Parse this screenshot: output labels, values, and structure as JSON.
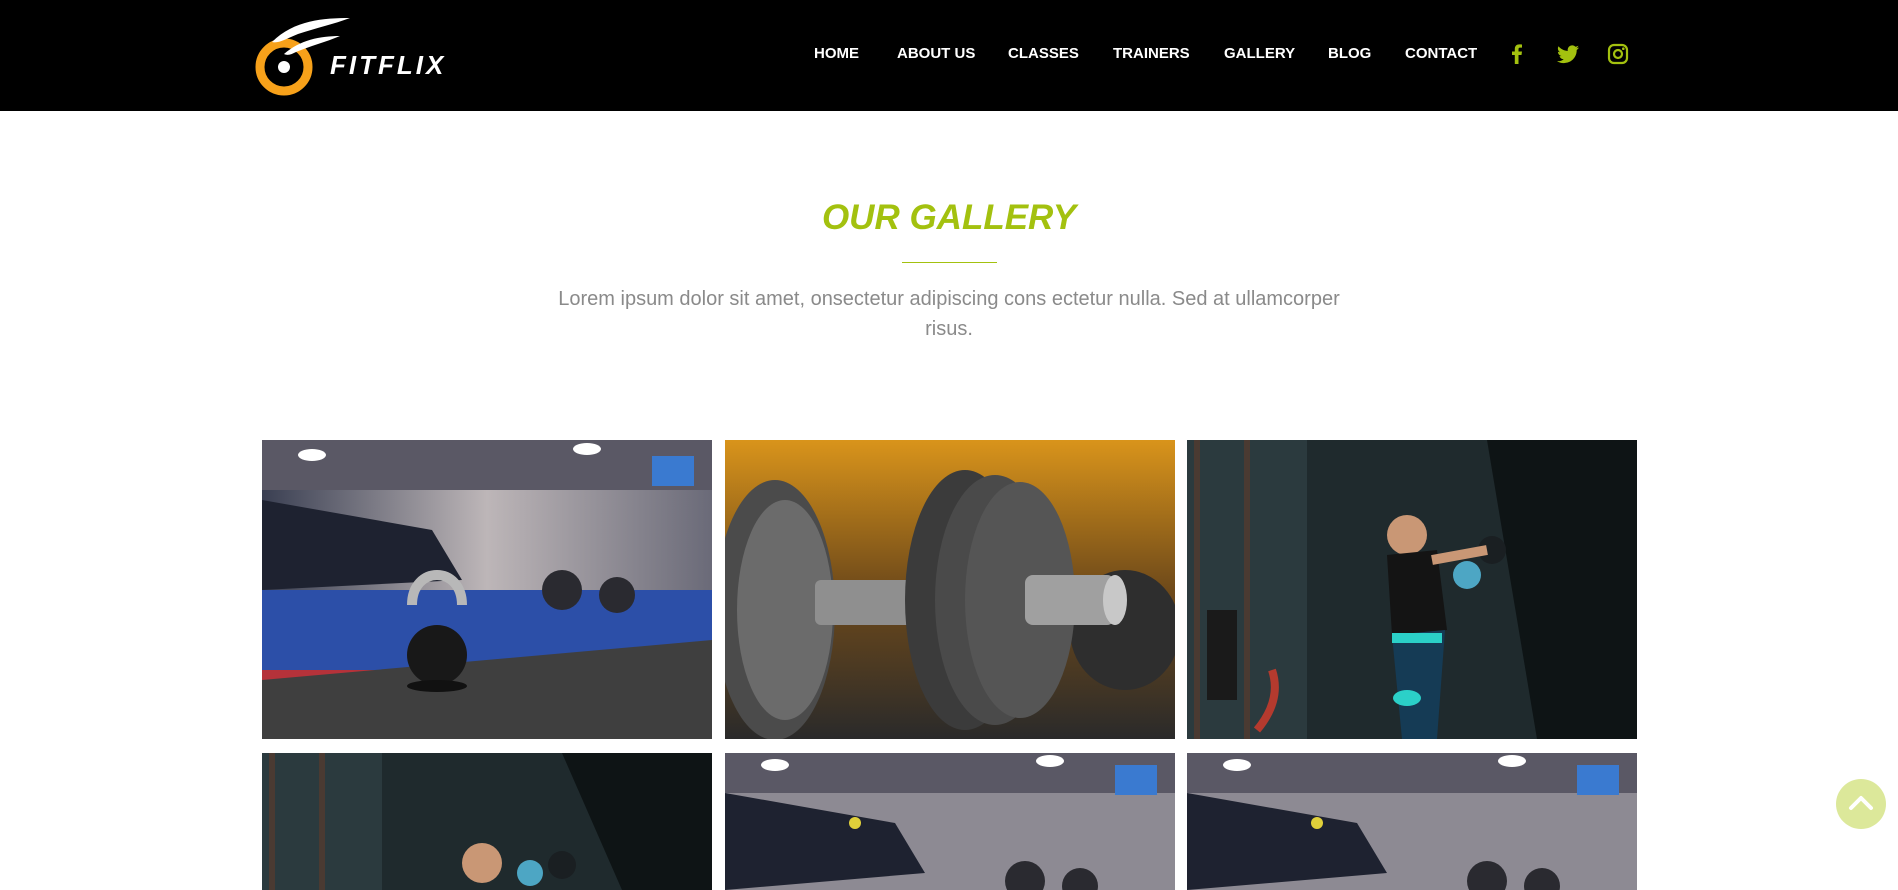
{
  "brand": {
    "name": "FITFLIX",
    "accent": "#a3c10f",
    "logo_orange": "#f7a11a"
  },
  "nav": {
    "items": [
      {
        "label": "HOME"
      },
      {
        "label": "ABOUT US"
      },
      {
        "label": "CLASSES"
      },
      {
        "label": "TRAINERS"
      },
      {
        "label": "GALLERY"
      },
      {
        "label": "BLOG"
      },
      {
        "label": "CONTACT"
      }
    ],
    "social": [
      "facebook-icon",
      "twitter-icon",
      "instagram-icon"
    ]
  },
  "gallery": {
    "title": "OUR GALLERY",
    "description": "Lorem ipsum dolor sit amet, onsectetur adipiscing cons ectetur nulla. Sed at ullamcorper risus.",
    "images": [
      {
        "subject": "kettlebell"
      },
      {
        "subject": "dumbbell"
      },
      {
        "subject": "boxer"
      },
      {
        "subject": "boxer"
      },
      {
        "subject": "kettlebell"
      },
      {
        "subject": "kettlebell"
      }
    ]
  },
  "scroll_top_icon": "chevron-up-icon"
}
